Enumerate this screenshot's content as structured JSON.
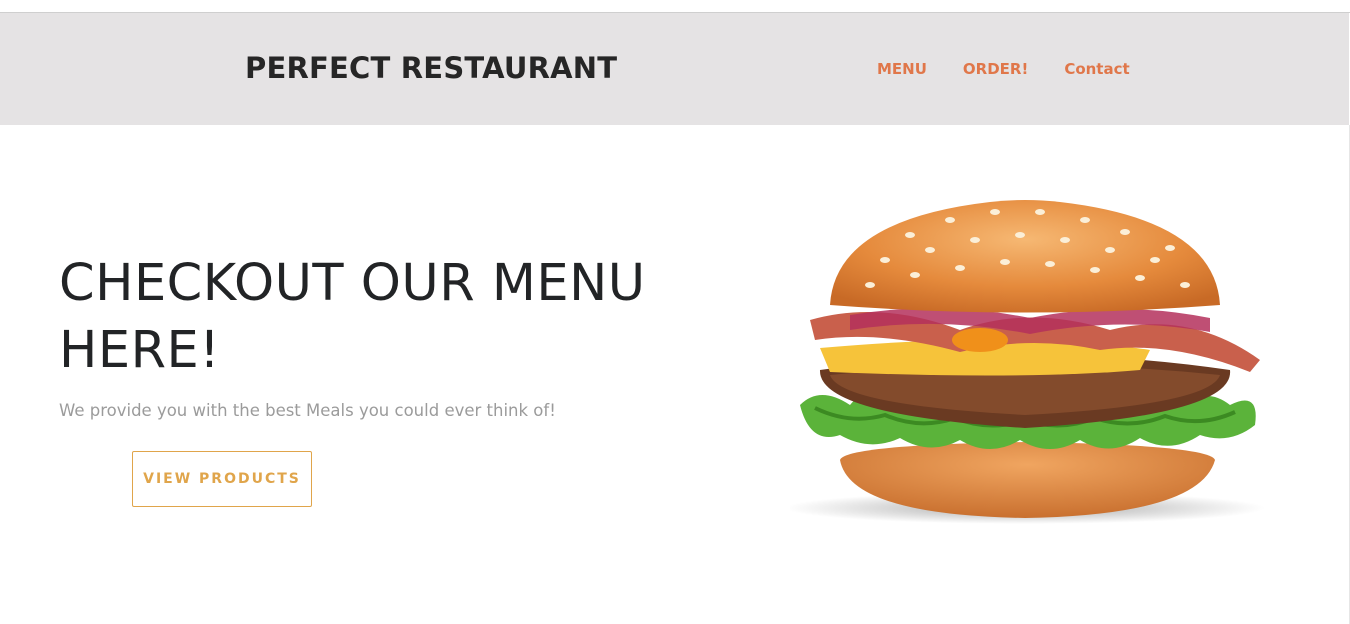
{
  "header": {
    "brand": "PERFECT RESTAURANT",
    "nav": [
      "MENU",
      "ORDER!",
      "Contact"
    ]
  },
  "hero": {
    "title": "CHECKOUT OUR MENU HERE!",
    "subtitle": "We provide you with the best Meals you could ever think of!",
    "cta_label": "VIEW PRODUCTS"
  },
  "colors": {
    "header_bg": "#e5e3e4",
    "nav_link": "#e0774a",
    "cta_accent": "#e0a54b",
    "title_text": "#222426",
    "subtitle_text": "#9b9b9b"
  },
  "images": {
    "hero_image": "burger-image"
  }
}
